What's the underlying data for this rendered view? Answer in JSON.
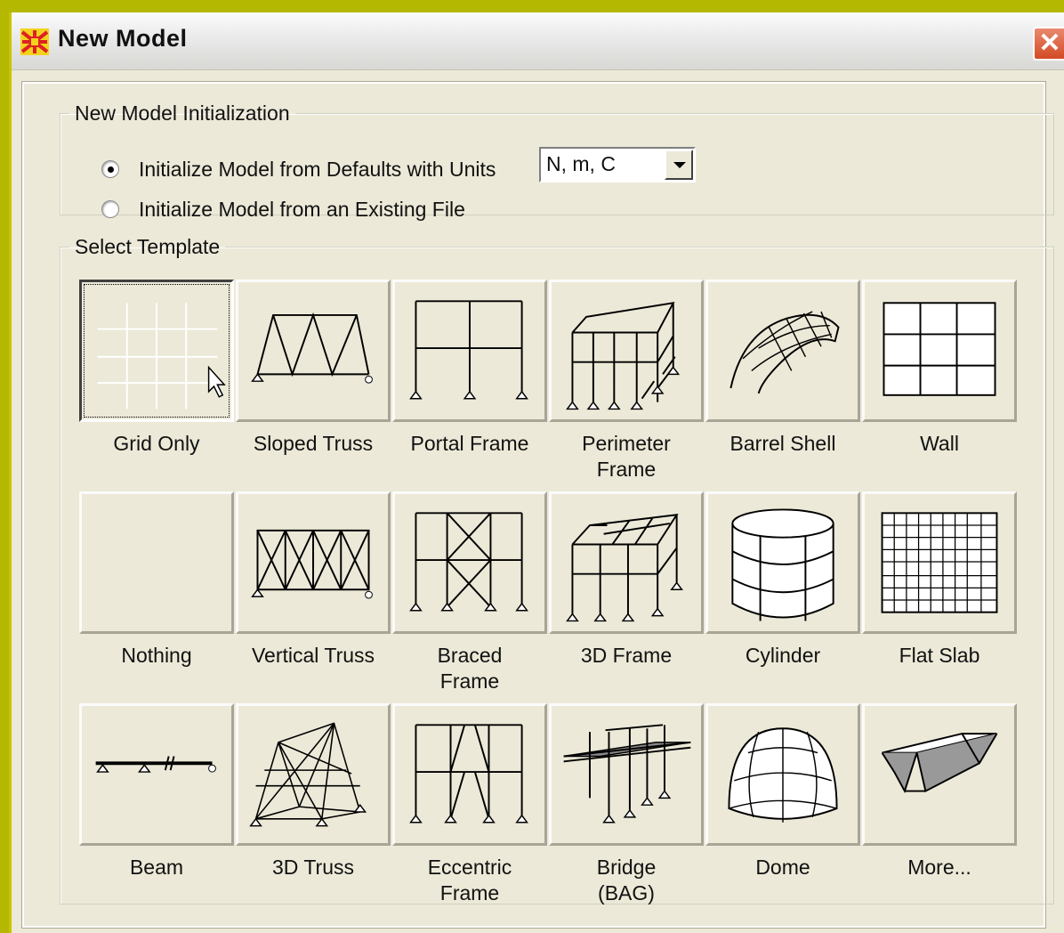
{
  "window": {
    "title": "New Model"
  },
  "init_group": {
    "legend": "New Model Initialization",
    "option_defaults": "Initialize Model from Defaults with Units",
    "option_file": "Initialize Model  from an Existing File",
    "selected_option": "defaults",
    "units": "N, m, C"
  },
  "template_group": {
    "legend": "Select Template",
    "selected_template": "Grid Only",
    "templates": [
      {
        "label": "Grid Only",
        "icon": "grid-icon"
      },
      {
        "label": "Sloped Truss",
        "icon": "sloped-truss-icon"
      },
      {
        "label": "Portal Frame",
        "icon": "portal-frame-icon"
      },
      {
        "label": "Perimeter\nFrame",
        "icon": "perimeter-frame-icon"
      },
      {
        "label": "Barrel Shell",
        "icon": "barrel-shell-icon"
      },
      {
        "label": "Wall",
        "icon": "wall-icon"
      },
      {
        "label": "Nothing",
        "icon": "blank-icon"
      },
      {
        "label": "Vertical Truss",
        "icon": "vertical-truss-icon"
      },
      {
        "label": "Braced\nFrame",
        "icon": "braced-frame-icon"
      },
      {
        "label": "3D Frame",
        "icon": "3d-frame-icon"
      },
      {
        "label": "Cylinder",
        "icon": "cylinder-icon"
      },
      {
        "label": "Flat Slab",
        "icon": "flat-slab-icon"
      },
      {
        "label": "Beam",
        "icon": "beam-icon"
      },
      {
        "label": "3D Truss",
        "icon": "3d-truss-icon"
      },
      {
        "label": "Eccentric\nFrame",
        "icon": "eccentric-frame-icon"
      },
      {
        "label": "Bridge\n(BAG)",
        "icon": "bridge-icon"
      },
      {
        "label": "Dome",
        "icon": "dome-icon"
      },
      {
        "label": "More...",
        "icon": "more-box-girder-icon"
      }
    ]
  },
  "colors": {
    "accent_titlebar": "#e6e6e6",
    "close_button": "#d34a24",
    "dialog_bg": "#ece9d8",
    "desktop": "#b5b800"
  }
}
